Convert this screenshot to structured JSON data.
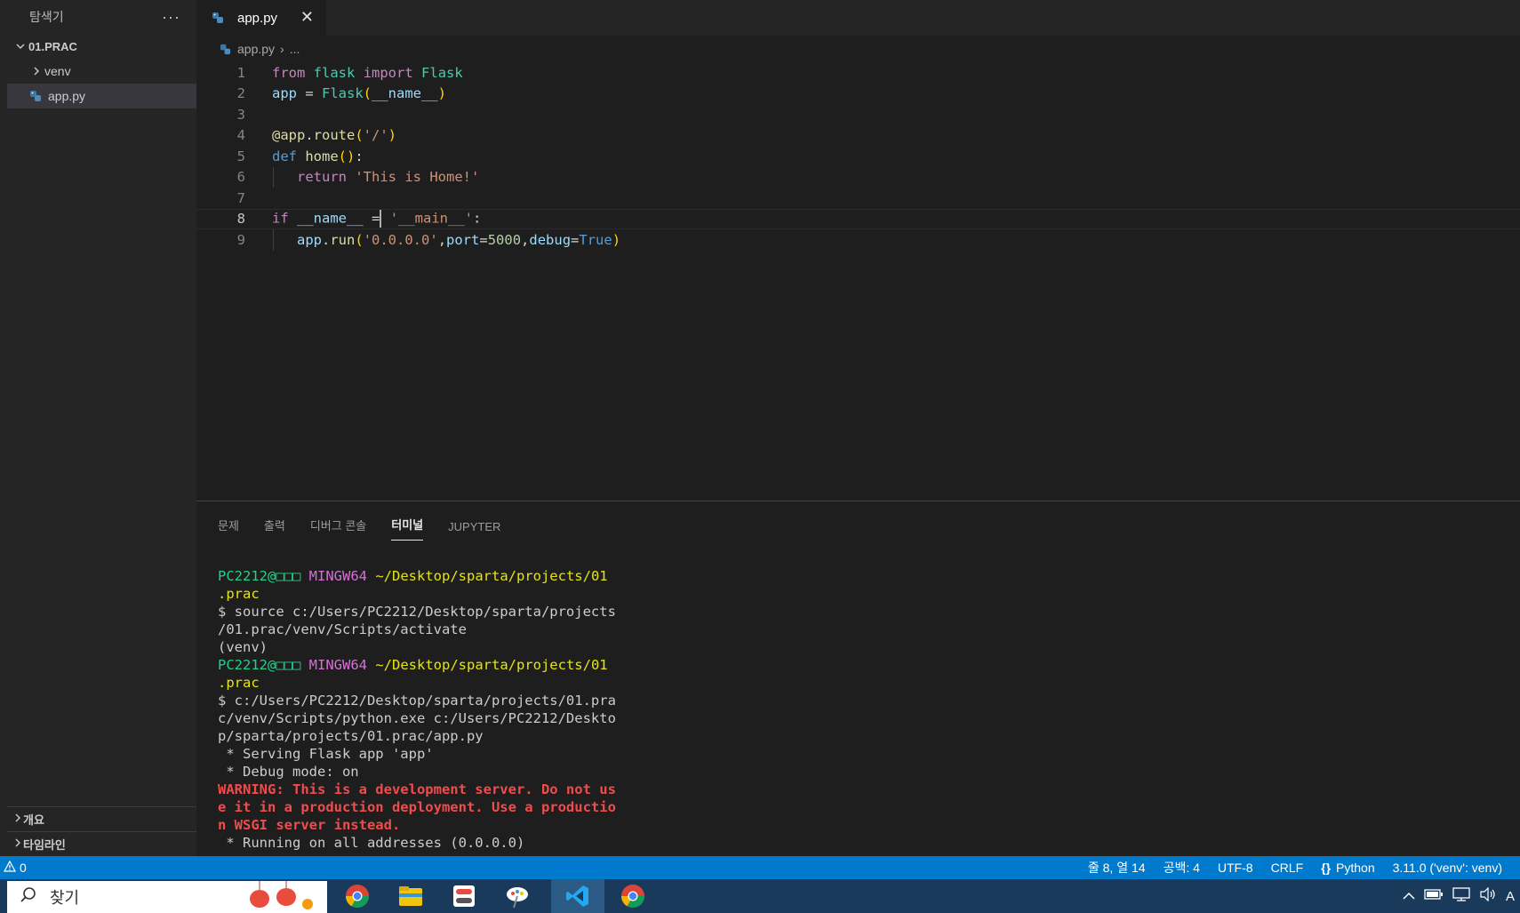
{
  "sidebar": {
    "title": "탐색기",
    "more": "···",
    "folder": "01.PRAC",
    "items": [
      {
        "label": "venv",
        "type": "folder"
      },
      {
        "label": "app.py",
        "type": "file"
      }
    ],
    "outline": "개요",
    "timeline": "타임라인"
  },
  "editor": {
    "tab_label": "app.py",
    "close_glyph": "✕",
    "breadcrumb_file": "app.py",
    "breadcrumb_sep": "›",
    "breadcrumb_more": "...",
    "line_numbers": [
      "1",
      "2",
      "3",
      "4",
      "5",
      "6",
      "7",
      "8",
      "9"
    ],
    "active_line": "8"
  },
  "panel": {
    "tabs": [
      "문제",
      "출력",
      "디버그 콘솔",
      "터미널",
      "JUPYTER"
    ],
    "active_tab": "터미널"
  },
  "terminal": {
    "user_host": "PC2212@□□□",
    "mingw": "MINGW64",
    "path1": "~/Desktop/sparta/projects/01",
    "path2": ".prac",
    "cmd1a": "$ source c:/Users/PC2212/Desktop/sparta/projects",
    "cmd1b": "/01.prac/venv/Scripts/activate",
    "venv": "(venv)",
    "cmd2a": "$ c:/Users/PC2212/Desktop/sparta/projects/01.pra",
    "cmd2b": "c/venv/Scripts/python.exe c:/Users/PC2212/Deskto",
    "cmd2c": "p/sparta/projects/01.prac/app.py",
    "serving": " * Serving Flask app 'app'",
    "debug": " * Debug mode: on",
    "warn1": "WARNING: This is a development server. Do not us",
    "warn2": "e it in a production deployment. Use a productio",
    "warn3": "n WSGI server instead.",
    "running": " * Running on all addresses (0.0.0.0)"
  },
  "statusbar": {
    "warnings": "0",
    "position": "줄 8, 열 14",
    "spaces": "공백: 4",
    "encoding": "UTF-8",
    "eol": "CRLF",
    "language": "Python",
    "interpreter": "3.11.0 ('venv': venv)"
  },
  "taskbar": {
    "search_placeholder": "찾기",
    "ime": "A"
  },
  "colors": {
    "accent": "#007acc",
    "editor_bg": "#1e1e1e",
    "sidebar_bg": "#252526"
  }
}
